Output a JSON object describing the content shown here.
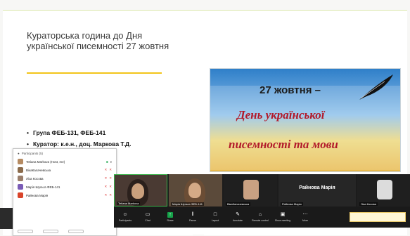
{
  "slide": {
    "title": "Кураторська година до Дня української писемності 27 жовтня",
    "bullets": [
      "Група ФЕБ-131, ФЕБ-141",
      "Куратор: к.е.н., доц. Маркова Т.Д."
    ]
  },
  "poster": {
    "date_text": "27 жовтня –",
    "line1": "День української",
    "line2": "писемності та мови",
    "colors": {
      "sky": "#2f7fc9",
      "field": "#e7b84c",
      "script": "#b21a2a"
    }
  },
  "participants": {
    "header": "Participants (5)",
    "rows": [
      {
        "name": "Tetiana Markova (Host, me)",
        "avatar_color": "#b58b62",
        "state": "on"
      },
      {
        "name": "ВікаКалачевська",
        "avatar_color": "#8b6b4b",
        "state": "muted"
      },
      {
        "name": "Ліза Косова",
        "avatar_color": "#9a7e6a",
        "state": "muted"
      },
      {
        "name": "Марія Шульга ФЕБ-141",
        "avatar_color": "#7a5bb6",
        "state": "muted"
      },
      {
        "name": "Райнова Марія",
        "avatar_color": "#d9442a",
        "state": "muted"
      }
    ]
  },
  "strip": {
    "tiles": [
      {
        "label": "Tetiana Markova"
      },
      {
        "label": "Марія Шульга ФЕБ-141"
      },
      {
        "label": "ВікаКалачевська"
      },
      {
        "label": "Райнова Марія",
        "center_name": "Райнова Марія"
      },
      {
        "label": "Ліза Косова"
      }
    ]
  },
  "toolbar": {
    "buttons": [
      {
        "label": "Participants",
        "icon": "participants-icon"
      },
      {
        "label": "Chat",
        "icon": "chat-icon"
      },
      {
        "label": "Share",
        "icon": "share-icon"
      },
      {
        "label": "Pause",
        "icon": "pause-icon"
      },
      {
        "label": "Layout",
        "icon": "layout-icon"
      },
      {
        "label": "Annotate",
        "icon": "annotate-icon"
      },
      {
        "label": "Remote control",
        "icon": "remote-control-icon"
      },
      {
        "label": "Show meeting",
        "icon": "show-meeting-icon"
      },
      {
        "label": "More",
        "icon": "more-icon"
      }
    ]
  }
}
